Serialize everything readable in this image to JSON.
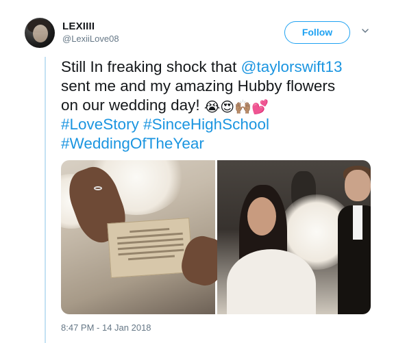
{
  "user": {
    "display_name": "LEXIIII",
    "handle": "@LexiiLove08"
  },
  "follow_label": "Follow",
  "tweet": {
    "line1_prefix": "Still In freaking shock that ",
    "mention": "@taylorswift13",
    "line2": "sent me and my amazing Hubby flowers",
    "line3": "on our wedding day! ",
    "emoji_crying": "😭",
    "emoji_heart_eyes": "😍",
    "emoji_raised_hands": "🙌🏽",
    "emoji_two_hearts": "💕",
    "hashtag1": "#LoveStory",
    "hashtag2": "#SinceHighSchool",
    "hashtag3": "#WeddingOfTheYear"
  },
  "media": {
    "left_photo": "card-in-hands-photo",
    "right_photo": "bride-and-groom-photo"
  },
  "timestamp": "8:47 PM - 14 Jan 2018",
  "colors": {
    "link": "#1b95e0",
    "follow_blue": "#1da1f2",
    "meta_gray": "#657786",
    "thread_line": "#c4e1f3"
  }
}
